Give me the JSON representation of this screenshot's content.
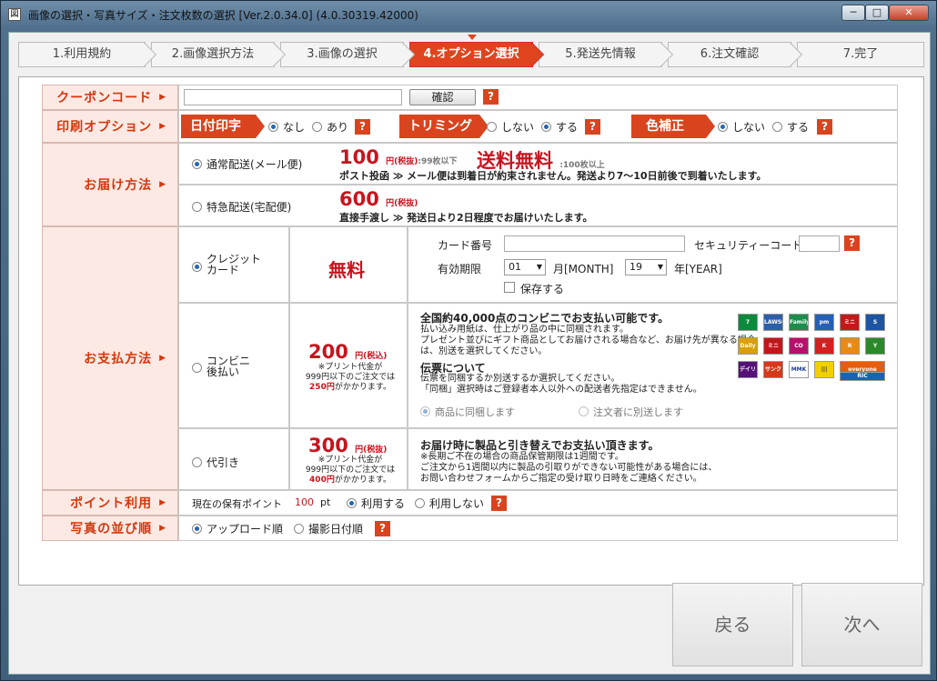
{
  "window": {
    "title": "画像の選択・写真サイズ・注文枚数の選択 [Ver.2.0.34.0] (4.0.30319.42000)",
    "min": "─",
    "max": "□",
    "close": "✕"
  },
  "steps": [
    "1.利用規約",
    "2.画像選択方法",
    "3.画像の選択",
    "4.オプション選択",
    "5.発送先情報",
    "6.注文確認",
    "7.完了"
  ],
  "coupon": {
    "label": "クーポンコード",
    "value": "",
    "button": "確認"
  },
  "print": {
    "label": "印刷オプション",
    "date_tag": "日付印字",
    "date_opts": [
      "なし",
      "あり"
    ],
    "trim_tag": "トリミング",
    "trim_opts": [
      "しない",
      "する"
    ],
    "color_tag": "色補正",
    "color_opts": [
      "しない",
      "する"
    ]
  },
  "delivery": {
    "label": "お届け方法",
    "mail": {
      "name": "通常配送(メール便)",
      "price": "100",
      "unit": "円(税抜)",
      "cond": ":99枚以下",
      "free": "送料無料",
      "free_cond": ":100枚以上",
      "desc": "ポスト投函 ≫ メール便は到着日が約束されません。発送より7〜10日前後で到着いたします。"
    },
    "express": {
      "name": "特急配送(宅配便)",
      "price": "600",
      "unit": "円(税抜)",
      "desc": "直接手渡し ≫ 発送日より2日程度でお届けいたします。"
    }
  },
  "payment": {
    "label": "お支払方法",
    "credit": {
      "name1": "クレジット",
      "name2": "カード",
      "price": "無料",
      "card_no": "カード番号",
      "sec": "セキュリティーコード",
      "expiry": "有効期限",
      "month": "01",
      "month_unit": "月[MONTH]",
      "year": "19",
      "year_unit": "年[YEAR]",
      "save": "保存する"
    },
    "conv": {
      "name1": "コンビニ",
      "name2": "後払い",
      "price": "200",
      "unit": "円(税込)",
      "n1": "※プリント代金が",
      "n2": "999円以下のご注文では",
      "n3a": "250円",
      "n3b": "がかかります。",
      "title": "全国約40,000点のコンビニでお支払い可能です。",
      "t1": "払い込み用紙は、仕上がり品の中に同梱されます。",
      "t2": "プレゼント並びにギフト商品としてお届けされる場合など、お届け先が異なる場合",
      "t3": "は、別送を選択してください。",
      "slip": "伝票について",
      "s1": "伝票を同梱するか別送するか選択してください。",
      "s2": "「同梱」選択時はご登録者本人以外への配送者先指定はできません。",
      "opt1": "商品に同梱します",
      "opt2": "注文者に別送します"
    },
    "cod": {
      "name": "代引き",
      "price": "300",
      "unit": "円(税抜)",
      "n1": "※プリント代金が",
      "n2": "999円以下のご注文では",
      "n3a": "400円",
      "n3b": "がかかります。",
      "title": "お届け時に製品と引き替えでお支払い頂きます。",
      "t1": "※長期ご不在の場合の商品保管期限は1週間です。",
      "t2": "ご注文から1週間以内に製品の引取りができない可能性がある場合には、",
      "t3": "お問い合わせフォームからご指定の受け取り日時をご連絡ください。"
    }
  },
  "points": {
    "label": "ポイント利用",
    "current": "現在の保有ポイント",
    "value": "100",
    "unit": "pt",
    "use": "利用する",
    "nouse": "利用しない"
  },
  "sort": {
    "label": "写真の並び順",
    "upload": "アップロード順",
    "date": "撮影日付順"
  },
  "q": "?",
  "nav": {
    "back": "戻る",
    "next": "次へ"
  },
  "logos": [
    "7",
    "LAWSON",
    "FamilyMart",
    "pm",
    "ミニ",
    "S",
    "Daily",
    "ミニ",
    "CO",
    "K",
    "R",
    "Y",
    "デイリー",
    "サンクス",
    "MMK",
    "|||",
    "everyone",
    "RIC"
  ]
}
